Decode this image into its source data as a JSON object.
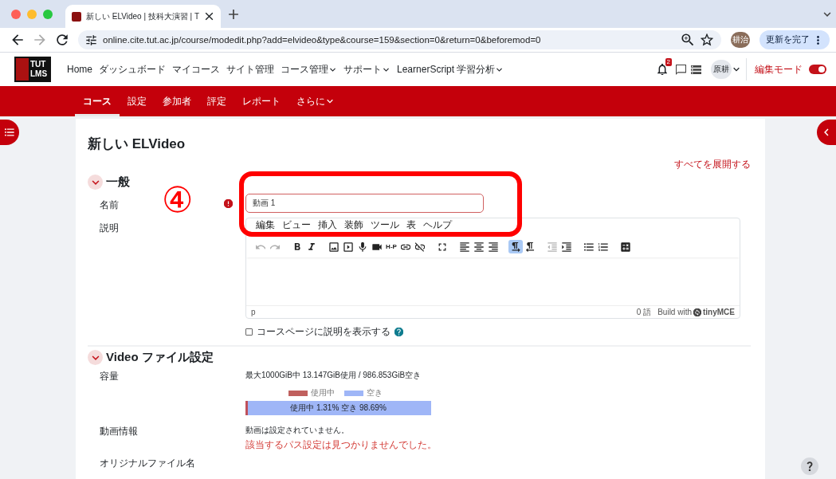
{
  "browser": {
    "tab_title": "新しい ELVideo | 技科大演習 | T",
    "url": "online.cite.tut.ac.jp/course/modedit.php?add=elvideo&type&course=159&section=0&return=0&beforemod=0",
    "avatar": "耕治",
    "update_button": "更新を完了"
  },
  "navbar": {
    "logo": [
      "TUT",
      "LMS"
    ],
    "items": [
      {
        "label": "Home",
        "dropdown": false
      },
      {
        "label": "ダッシュボード",
        "dropdown": false
      },
      {
        "label": "マイコース",
        "dropdown": false
      },
      {
        "label": "サイト管理",
        "dropdown": false
      },
      {
        "label": "コース管理",
        "dropdown": true
      },
      {
        "label": "サポート",
        "dropdown": true
      },
      {
        "label": "LearnerScript 学習分析",
        "dropdown": true
      }
    ],
    "notification_count": "2",
    "user": "原耕",
    "edit_mode": {
      "label": "編集モード",
      "on": true
    }
  },
  "secondary_nav": [
    {
      "label": "コース",
      "selected": true
    },
    {
      "label": "設定",
      "selected": false
    },
    {
      "label": "参加者",
      "selected": false
    },
    {
      "label": "評定",
      "selected": false
    },
    {
      "label": "レポート",
      "selected": false
    },
    {
      "label": "さらに",
      "selected": false,
      "dropdown": true
    }
  ],
  "page": {
    "title": "新しい ELVideo",
    "expand_all": "すべてを展開する"
  },
  "general": {
    "title": "一般",
    "expanded": true,
    "name": {
      "label": "名前",
      "value": "動画 1",
      "required": true
    },
    "description": {
      "label": "説明",
      "menu": [
        "編集",
        "ビュー",
        "挿入",
        "装飾",
        "ツール",
        "表",
        "ヘルプ"
      ],
      "toolbar": [
        {
          "selected": false,
          "disabled": true
        },
        {
          "selected": false,
          "disabled": true
        },
        {
          "selected": false,
          "disabled": false
        },
        {
          "selected": false,
          "disabled": false
        },
        {
          "selected": false,
          "disabled": false
        },
        {
          "selected": false,
          "disabled": false
        },
        {
          "selected": false,
          "disabled": false
        },
        {
          "selected": false,
          "disabled": false
        },
        {
          "label": "H-P",
          "selected": false,
          "disabled": false
        },
        {
          "selected": false,
          "disabled": false
        },
        {
          "selected": false,
          "disabled": false
        },
        {
          "selected": false,
          "disabled": false
        },
        {
          "selected": false,
          "disabled": false
        },
        {
          "selected": false,
          "disabled": false
        },
        {
          "selected": false,
          "disabled": false
        },
        {
          "selected": true,
          "disabled": false
        },
        {
          "selected": false,
          "disabled": false
        },
        {
          "selected": false,
          "disabled": true
        },
        {
          "selected": false,
          "disabled": false
        },
        {
          "selected": false,
          "disabled": false
        },
        {
          "selected": false,
          "disabled": false
        },
        {
          "selected": false,
          "disabled": false
        }
      ],
      "path": "p",
      "word_count": "0 語",
      "branding": "Build with",
      "brand": "tinyMCE"
    },
    "show_on_course_page": {
      "label": "コースページに説明を表示する",
      "checked": false
    }
  },
  "video": {
    "title": "Video ファイル設定",
    "expanded": true,
    "capacity": {
      "label": "容量",
      "summary": "最大1000GiB中 13.147GiB使用 / 986.853GiB空き",
      "legend": [
        {
          "label": "使用中",
          "color": "#c0605e"
        },
        {
          "label": "空き",
          "color": "#9fb6f7"
        }
      ],
      "level": 0.0131,
      "bar_text": "使用中 1.31% 空き 98.69%"
    },
    "video_info": {
      "label": "動画情報",
      "message": "動画は設定されていません。",
      "error": "該当するパス設定は見つかりませんでした。"
    },
    "original_filename": {
      "label": "オリジナルファイル名"
    }
  },
  "annotation": {
    "label": "④"
  }
}
